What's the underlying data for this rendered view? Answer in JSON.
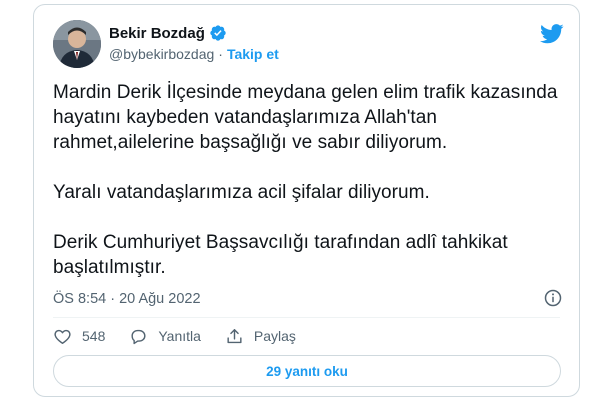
{
  "tweet": {
    "author_name": "Bekir Bozdağ",
    "handle": "@bybekirbozdag",
    "separator": "·",
    "follow_label": "Takip et",
    "paragraphs": [
      "Mardin Derik İlçesinde meydana gelen elim trafik kazasında hayatını kaybeden vatandaşlarımıza Allah'tan rahmet,ailelerine başsağlığı ve sabır diliyorum.",
      "Yaralı vatandaşlarımıza acil şifalar diliyorum.",
      "Derik Cumhuriyet Başsavcılığı tarafından adlî tahkikat başlatılmıştır."
    ],
    "timestamp": "ÖS 8:54 · 20 Ağu 2022",
    "likes": "548",
    "reply_label": "Yanıtla",
    "share_label": "Paylaş",
    "read_replies_label": "29 yanıtı oku"
  },
  "colors": {
    "accent": "#1d9bf0",
    "text": "#0f1419",
    "secondary": "#536471",
    "border": "#cfd9de"
  },
  "icons": [
    "verified-badge-icon",
    "twitter-bird-icon",
    "info-icon",
    "heart-icon",
    "reply-icon",
    "share-icon"
  ]
}
